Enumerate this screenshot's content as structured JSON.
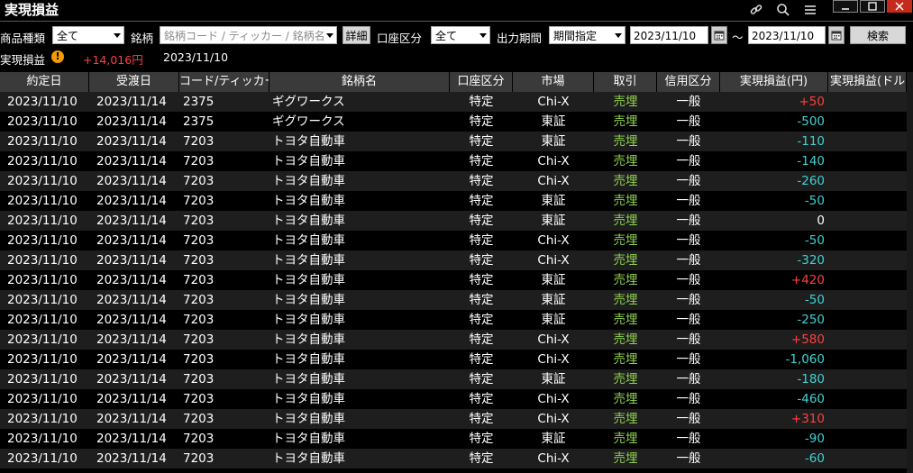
{
  "header": {
    "title": "実現損益",
    "icons": [
      "link-icon",
      "search-icon",
      "menu-icon",
      "minimize-icon",
      "maximize-icon",
      "close-icon"
    ]
  },
  "filters": {
    "product_type_label": "商品種類",
    "product_type_value": "全て",
    "symbol_label": "銘柄",
    "symbol_placeholder": "銘柄コード / ティッカー / 銘柄名",
    "detail_button": "詳細",
    "account_label": "口座区分",
    "account_value": "全て",
    "period_label": "出力期間",
    "period_value": "期間指定",
    "date_from": "2023/11/10",
    "date_separator": "～",
    "date_to": "2023/11/10",
    "search_button": "検索"
  },
  "summary": {
    "label": "実現損益",
    "total": "+14,016円",
    "date": "2023/11/10"
  },
  "colors": {
    "positive": "#ff4040",
    "negative": "#3fd2d2",
    "sell": "#8fd14f"
  },
  "table": {
    "columns": [
      "約定日",
      "受渡日",
      "コード/ティッカー",
      "銘柄名",
      "口座区分",
      "市場",
      "取引",
      "信用区分",
      "実現損益(円)",
      "実現損益(ドル)"
    ],
    "rows": [
      {
        "trade_date": "2023/11/10",
        "settle_date": "2023/11/14",
        "code": "2375",
        "name": "ギグワークス",
        "account": "特定",
        "market": "Chi-X",
        "trade": "売埋",
        "margin": "一般",
        "pnl": "+50",
        "sign": "pos"
      },
      {
        "trade_date": "2023/11/10",
        "settle_date": "2023/11/14",
        "code": "2375",
        "name": "ギグワークス",
        "account": "特定",
        "market": "東証",
        "trade": "売埋",
        "margin": "一般",
        "pnl": "-500",
        "sign": "neg"
      },
      {
        "trade_date": "2023/11/10",
        "settle_date": "2023/11/14",
        "code": "7203",
        "name": "トヨタ自動車",
        "account": "特定",
        "market": "東証",
        "trade": "売埋",
        "margin": "一般",
        "pnl": "-110",
        "sign": "neg"
      },
      {
        "trade_date": "2023/11/10",
        "settle_date": "2023/11/14",
        "code": "7203",
        "name": "トヨタ自動車",
        "account": "特定",
        "market": "Chi-X",
        "trade": "売埋",
        "margin": "一般",
        "pnl": "-140",
        "sign": "neg"
      },
      {
        "trade_date": "2023/11/10",
        "settle_date": "2023/11/14",
        "code": "7203",
        "name": "トヨタ自動車",
        "account": "特定",
        "market": "Chi-X",
        "trade": "売埋",
        "margin": "一般",
        "pnl": "-260",
        "sign": "neg"
      },
      {
        "trade_date": "2023/11/10",
        "settle_date": "2023/11/14",
        "code": "7203",
        "name": "トヨタ自動車",
        "account": "特定",
        "market": "東証",
        "trade": "売埋",
        "margin": "一般",
        "pnl": "-50",
        "sign": "neg"
      },
      {
        "trade_date": "2023/11/10",
        "settle_date": "2023/11/14",
        "code": "7203",
        "name": "トヨタ自動車",
        "account": "特定",
        "market": "東証",
        "trade": "売埋",
        "margin": "一般",
        "pnl": "0",
        "sign": "zero"
      },
      {
        "trade_date": "2023/11/10",
        "settle_date": "2023/11/14",
        "code": "7203",
        "name": "トヨタ自動車",
        "account": "特定",
        "market": "Chi-X",
        "trade": "売埋",
        "margin": "一般",
        "pnl": "-50",
        "sign": "neg"
      },
      {
        "trade_date": "2023/11/10",
        "settle_date": "2023/11/14",
        "code": "7203",
        "name": "トヨタ自動車",
        "account": "特定",
        "market": "Chi-X",
        "trade": "売埋",
        "margin": "一般",
        "pnl": "-320",
        "sign": "neg"
      },
      {
        "trade_date": "2023/11/10",
        "settle_date": "2023/11/14",
        "code": "7203",
        "name": "トヨタ自動車",
        "account": "特定",
        "market": "東証",
        "trade": "売埋",
        "margin": "一般",
        "pnl": "+420",
        "sign": "pos"
      },
      {
        "trade_date": "2023/11/10",
        "settle_date": "2023/11/14",
        "code": "7203",
        "name": "トヨタ自動車",
        "account": "特定",
        "market": "東証",
        "trade": "売埋",
        "margin": "一般",
        "pnl": "-50",
        "sign": "neg"
      },
      {
        "trade_date": "2023/11/10",
        "settle_date": "2023/11/14",
        "code": "7203",
        "name": "トヨタ自動車",
        "account": "特定",
        "market": "東証",
        "trade": "売埋",
        "margin": "一般",
        "pnl": "-250",
        "sign": "neg"
      },
      {
        "trade_date": "2023/11/10",
        "settle_date": "2023/11/14",
        "code": "7203",
        "name": "トヨタ自動車",
        "account": "特定",
        "market": "Chi-X",
        "trade": "売埋",
        "margin": "一般",
        "pnl": "+580",
        "sign": "pos"
      },
      {
        "trade_date": "2023/11/10",
        "settle_date": "2023/11/14",
        "code": "7203",
        "name": "トヨタ自動車",
        "account": "特定",
        "market": "Chi-X",
        "trade": "売埋",
        "margin": "一般",
        "pnl": "-1,060",
        "sign": "neg"
      },
      {
        "trade_date": "2023/11/10",
        "settle_date": "2023/11/14",
        "code": "7203",
        "name": "トヨタ自動車",
        "account": "特定",
        "market": "東証",
        "trade": "売埋",
        "margin": "一般",
        "pnl": "-180",
        "sign": "neg"
      },
      {
        "trade_date": "2023/11/10",
        "settle_date": "2023/11/14",
        "code": "7203",
        "name": "トヨタ自動車",
        "account": "特定",
        "market": "Chi-X",
        "trade": "売埋",
        "margin": "一般",
        "pnl": "-460",
        "sign": "neg"
      },
      {
        "trade_date": "2023/11/10",
        "settle_date": "2023/11/14",
        "code": "7203",
        "name": "トヨタ自動車",
        "account": "特定",
        "market": "Chi-X",
        "trade": "売埋",
        "margin": "一般",
        "pnl": "+310",
        "sign": "pos"
      },
      {
        "trade_date": "2023/11/10",
        "settle_date": "2023/11/14",
        "code": "7203",
        "name": "トヨタ自動車",
        "account": "特定",
        "market": "東証",
        "trade": "売埋",
        "margin": "一般",
        "pnl": "-90",
        "sign": "neg"
      },
      {
        "trade_date": "2023/11/10",
        "settle_date": "2023/11/14",
        "code": "7203",
        "name": "トヨタ自動車",
        "account": "特定",
        "market": "Chi-X",
        "trade": "売埋",
        "margin": "一般",
        "pnl": "-60",
        "sign": "neg"
      }
    ]
  }
}
